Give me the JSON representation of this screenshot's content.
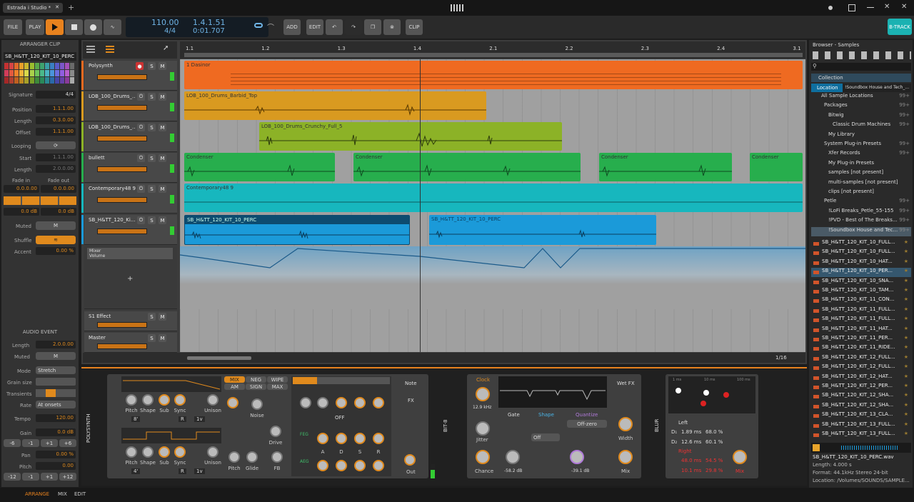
{
  "window": {
    "title": "Estrada i Studio *",
    "close": "✕",
    "add": "+"
  },
  "transport": {
    "file": "FILE",
    "play": "PLAY",
    "tempo": "110.00",
    "signature": "4/4",
    "position": "1.4.1.51",
    "time": "0:01.707",
    "add": "ADD",
    "edit": "EDIT",
    "clip": "CLIP",
    "btrack": "B-TRACK"
  },
  "inspector": {
    "header": "ARRANGER CLIP",
    "clip_name": "SB_H&TT_120_KIT_10_PERC",
    "signature_label": "Signature",
    "signature": "4/4",
    "position_label": "Position",
    "position": "1.1.1.00",
    "length_label": "Length",
    "length": "0.3.0.00",
    "offset_label": "Offset",
    "offset": "1.1.1.00",
    "looping_label": "Looping",
    "start_label": "Start",
    "start": "1.1.1.00",
    "loop_length_label": "Length",
    "loop_length": "2.0.0.00",
    "fadein_label": "Fade in",
    "fadeout_label": "Fade out",
    "fadein": "0.0.0.00",
    "fadeout": "0.0.0.00",
    "db1": "0.0 dB",
    "db2": "0.0 dB",
    "muted_label": "Muted",
    "m": "M",
    "shuffle_label": "Shuffle",
    "accent_label": "Accent",
    "accent": "0.00 %",
    "colors": [
      "#c43232",
      "#d64545",
      "#e06a2a",
      "#e8a02a",
      "#c9b52e",
      "#9bbd2e",
      "#59a84a",
      "#3ea36e",
      "#3a9fa6",
      "#3a7fc2",
      "#5a5ac8",
      "#7b56c9",
      "#a44fb8",
      "#6a6a6a",
      "#d23c5a",
      "#e35a3e",
      "#f0822a",
      "#f0b43a",
      "#d9d94a",
      "#aad04a",
      "#6ec45a",
      "#4ab98a",
      "#4ab4c2",
      "#4a94dc",
      "#6c6ce0",
      "#905ee0",
      "#b85ecc",
      "#8a8a8a",
      "#a52828",
      "#b04030",
      "#c06020",
      "#c08a20",
      "#a8a028",
      "#7aa028",
      "#3d8a3a",
      "#2a8a5a",
      "#2a8a94",
      "#2a6aaa",
      "#4646aa",
      "#6640aa",
      "#8a3a9a",
      "#aaaaaa"
    ]
  },
  "audio_event": {
    "header": "AUDIO EVENT",
    "length_label": "Length",
    "length": "2.0.0.00",
    "muted_label": "Muted",
    "m": "M",
    "mode_label": "Mode",
    "mode": "Stretch",
    "grain_label": "Grain size",
    "transients_label": "Transients",
    "rate_label": "Rate",
    "rate": "At onsets",
    "tempo_label": "Tempo",
    "tempo": "120.00",
    "gain_label": "Gain",
    "gain": "0.0 dB",
    "gain_btns": [
      "-6",
      "-1",
      "+1",
      "+6"
    ],
    "pan_label": "Pan",
    "pan": "0.00 %",
    "pitch_label": "Pitch",
    "pitch": "0.00",
    "pitch_btns": [
      "-12",
      "-1",
      "+1",
      "+12"
    ]
  },
  "ruler": {
    "marks": [
      "1.1",
      "1.2",
      "1.3",
      "1.4",
      "2.1",
      "2.2",
      "2.3",
      "2.4",
      "3.1"
    ]
  },
  "tracks": [
    {
      "name": "Polysynth",
      "s": "S",
      "m": "M",
      "color": "#ef6a21"
    },
    {
      "name": "LOB_100_Drums_...",
      "s": "S",
      "m": "M",
      "color": "#d99a20"
    },
    {
      "name": "LOB_100_Drums_...",
      "s": "S",
      "m": "M",
      "color": "#8cb227"
    },
    {
      "name": "bullett",
      "s": "S",
      "m": "M",
      "color": "#27ae4d"
    },
    {
      "name": "Contemporary48 9",
      "s": "S",
      "m": "M",
      "color": "#17b7be"
    },
    {
      "name": "SB_H&TT_120_Ki...",
      "s": "S",
      "m": "M",
      "color": "#1b9ad9"
    }
  ],
  "automation": {
    "label1": "Mixer",
    "label2": "Volume"
  },
  "fx_tracks": [
    {
      "name": "S1 Effect",
      "s": "S",
      "m": "M"
    },
    {
      "name": "Master",
      "s": "S",
      "m": "M"
    }
  ],
  "clips": {
    "c1": "1 Dasinor",
    "c2": "LOB_100_Drums_Barbid_Top",
    "c3": "LOB_100_Drums_Crunchy_Full_5",
    "c4": "Condenser",
    "c5": "Condenser",
    "c6": "Condenser",
    "c7": "Condenser",
    "c8": "Contemporary48 9",
    "c9": "SB_H&TT_120_KIT_10_PERC",
    "c10": "SB_H&TT_120_KIT_10_PERC"
  },
  "zoom": "1/16",
  "browser": {
    "title": "Browser - Samples",
    "collection": "Collection",
    "location_label": "Location",
    "location_value": "!Soundbox House and Tech_...",
    "tree": [
      {
        "label": "All Sample Locations",
        "n": "99+"
      },
      {
        "label": "Packages",
        "n": "99+"
      },
      {
        "label": "Bitwig",
        "n": "99+"
      },
      {
        "label": "Classic Drum Machines",
        "n": "99+"
      },
      {
        "label": "My Library",
        "n": ""
      },
      {
        "label": "System Plug-in Presets",
        "n": "99+"
      },
      {
        "label": "Xfer Records",
        "n": "99+"
      },
      {
        "label": "My Plug-in Presets",
        "n": ""
      },
      {
        "label": "samples [not present]",
        "n": ""
      },
      {
        "label": "multi-samples [not present]",
        "n": ""
      },
      {
        "label": "clips [not present]",
        "n": ""
      },
      {
        "label": "Petle",
        "n": "99+"
      },
      {
        "label": "!LoFi Breaks_Petle_55-155",
        "n": "99+"
      },
      {
        "label": "!PVD - Best of The Breaks...",
        "n": "99+"
      },
      {
        "label": "!Soundbox House and Tec...",
        "n": "99+"
      }
    ],
    "files": [
      "SB_H&TT_120_KIT_10_FULL...",
      "SB_H&TT_120_KIT_10_FULL...",
      "SB_H&TT_120_KIT_10_HAT...",
      "SB_H&TT_120_KIT_10_PER...",
      "SB_H&TT_120_KIT_10_SNA...",
      "SB_H&TT_120_KIT_10_TAM...",
      "SB_H&TT_120_KIT_11_CON...",
      "SB_H&TT_120_KIT_11_FULL...",
      "SB_H&TT_120_KIT_11_FULL...",
      "SB_H&TT_120_KIT_11_HAT...",
      "SB_H&TT_120_KIT_11_PER...",
      "SB_H&TT_120_KIT_11_RIDE...",
      "SB_H&TT_120_KIT_12_FULL...",
      "SB_H&TT_120_KIT_12_FULL...",
      "SB_H&TT_120_KIT_12_HAT...",
      "SB_H&TT_120_KIT_12_PER...",
      "SB_H&TT_120_KIT_12_SHA...",
      "SB_H&TT_120_KIT_12_SHA...",
      "SB_H&TT_120_KIT_13_CLA...",
      "SB_H&TT_120_KIT_13_FULL...",
      "SB_H&TT_120_KIT_13_FULL..."
    ],
    "info_name": "SB_H&TT_120_KIT_10_PERC.wav",
    "info_length": "Length: 4.000 s",
    "info_format": "Format: 44.1kHz Stereo 24-bit",
    "info_location": "Location: /Volumes/SOUNDS/SAMPLE..."
  },
  "devices": {
    "polysynth": "POLYSYNTH",
    "mix_tabs": [
      "MIX",
      "NEG",
      "WIPE",
      "AM",
      "SIGN",
      "MAX"
    ],
    "osc_knobs": [
      "Pitch",
      "Shape",
      "Sub",
      "Sync",
      "Unison"
    ],
    "osc1_vals": [
      "8'",
      "R",
      "1v"
    ],
    "osc2_vals": [
      "4'",
      "R",
      "1v"
    ],
    "mid_knobs": [
      "Noise",
      "Drive",
      "Pitch",
      "Glide",
      "FB"
    ],
    "off": "OFF",
    "feg": "FEG",
    "aeg": "AEG",
    "adsr": [
      "A",
      "D",
      "S",
      "R"
    ],
    "note": "Note",
    "fx": "FX",
    "out": "Out",
    "l": "L",
    "r": "R",
    "bit8": "BIT-8",
    "clock": "Clock",
    "clock_val": "12.9 kHz",
    "jitter": "Jitter",
    "chance": "Chance",
    "gate": "Gate",
    "gate_val": "-58.2 dB",
    "shape": "Shape",
    "shape_sel": "Off",
    "quantize": "Quantize",
    "quant_sel": "Off-zero",
    "quant_val": "-39.1 dB",
    "wetfx": "Wet FX",
    "width": "Width",
    "mix": "Mix",
    "blur": "BLUR",
    "scale": [
      "1 ms",
      "10 ms",
      "100 ms"
    ],
    "left": "Left",
    "right": "Right",
    "d1": "D₁",
    "d2": "D₂",
    "l1": "1.89 ms",
    "l1p": "68.0 %",
    "l2": "12.6 ms",
    "l2p": "60.1 %",
    "r1": "48.0 ms",
    "r1p": "54.5 %",
    "r2": "10.1 ms",
    "r2p": "29.8 %",
    "blur_mix": "Mix"
  },
  "footer": {
    "arrange": "ARRANGE",
    "mix": "MIX",
    "edit": "EDIT"
  }
}
